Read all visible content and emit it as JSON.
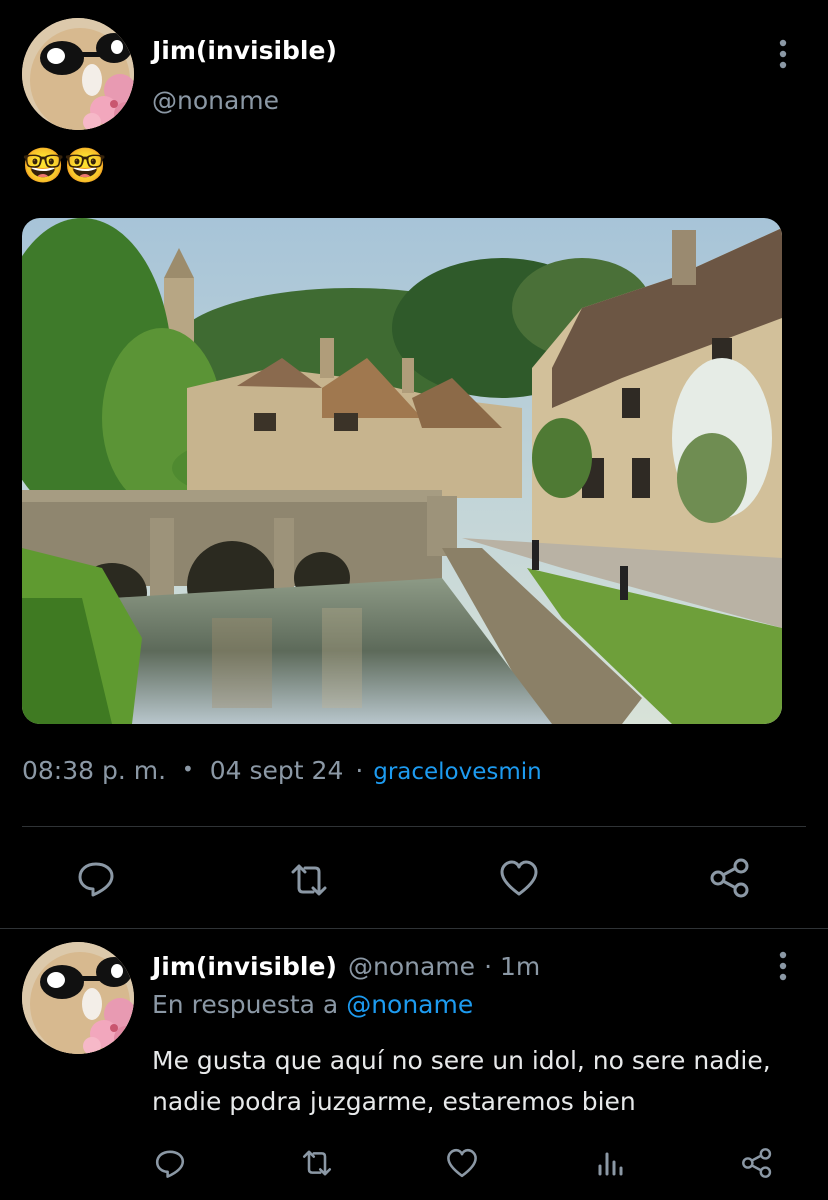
{
  "tweet": {
    "author_name": "Jim(invisible)",
    "author_handle": "@noname",
    "avatar_icon": "nerd-face-avatar-icon",
    "emoji_text": "🤓🤓",
    "time": "08:38 p. m.",
    "dot": "•",
    "date": "04 sept 24",
    "sep": "·",
    "source": "gracelovesmin",
    "photo_icon": "village-river-photo"
  },
  "reply": {
    "author_name": "Jim(invisible)",
    "author_handle": "@noname",
    "age": "· 1m",
    "in_reply_prefix": "En respuesta a",
    "in_reply_handle": "@noname",
    "text_line1": "Me gusta que aquí no sere un idol, no sere nadie,",
    "text_line2": "nadie podra juzgarme, estaremos bien"
  },
  "colors": {
    "background": "#000000",
    "text": "#e7e9ea",
    "muted": "#8b98a5",
    "accent": "#1d9bf0"
  }
}
